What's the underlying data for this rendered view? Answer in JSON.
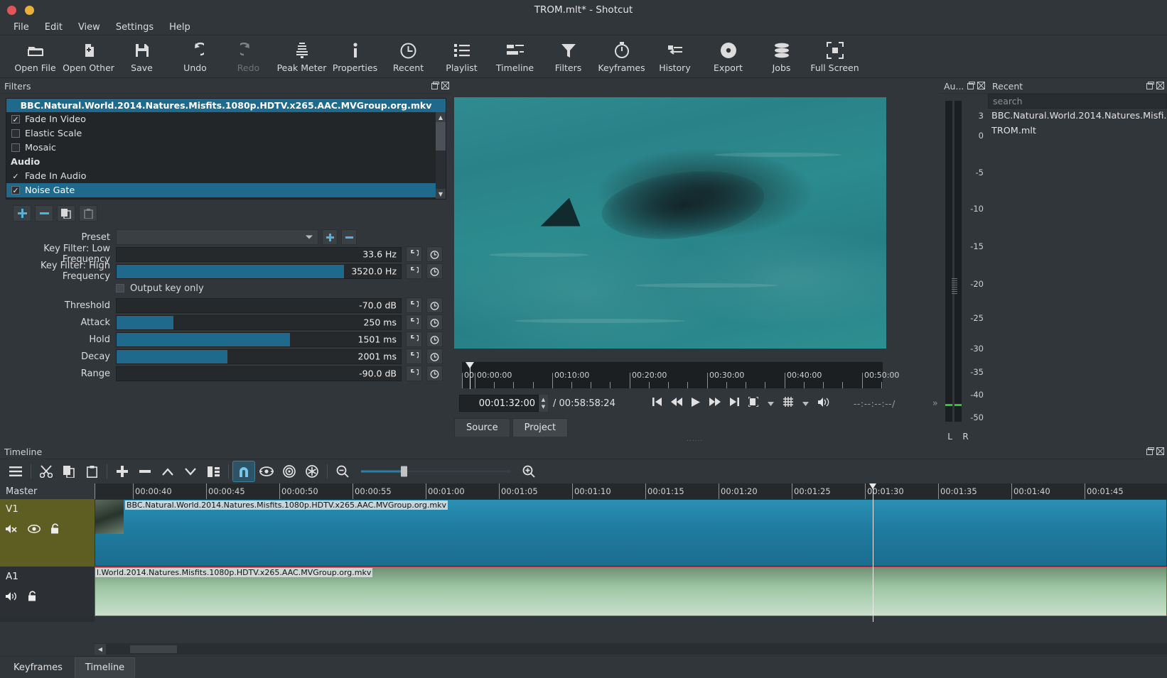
{
  "window": {
    "title": "TROM.mlt* - Shotcut",
    "buttons": [
      "close",
      "minimize"
    ]
  },
  "menubar": [
    {
      "label": "File"
    },
    {
      "label": "Edit"
    },
    {
      "label": "View"
    },
    {
      "label": "Settings"
    },
    {
      "label": "Help"
    }
  ],
  "toolbar": [
    {
      "label": "Open File",
      "icon": "folder-icon",
      "disabled": false
    },
    {
      "label": "Open Other",
      "icon": "open-other-icon",
      "disabled": false
    },
    {
      "label": "Save",
      "icon": "save-icon",
      "disabled": false
    },
    {
      "label": "Undo",
      "icon": "undo-icon",
      "disabled": false
    },
    {
      "label": "Redo",
      "icon": "redo-icon",
      "disabled": true
    },
    {
      "label": "Peak Meter",
      "icon": "peak-meter-icon",
      "disabled": false
    },
    {
      "label": "Properties",
      "icon": "info-icon",
      "disabled": false
    },
    {
      "label": "Recent",
      "icon": "clock-icon",
      "disabled": false
    },
    {
      "label": "Playlist",
      "icon": "list-icon",
      "disabled": false
    },
    {
      "label": "Timeline",
      "icon": "timeline-icon",
      "disabled": false
    },
    {
      "label": "Filters",
      "icon": "funnel-icon",
      "disabled": false
    },
    {
      "label": "Keyframes",
      "icon": "stopwatch-icon",
      "disabled": false
    },
    {
      "label": "History",
      "icon": "history-icon",
      "disabled": false
    },
    {
      "label": "Export",
      "icon": "disc-icon",
      "disabled": false
    },
    {
      "label": "Jobs",
      "icon": "stack-icon",
      "disabled": false
    },
    {
      "label": "Full Screen",
      "icon": "fullscreen-icon",
      "disabled": false
    }
  ],
  "filters_panel": {
    "dock_title": "Filters",
    "source_name": "BBC.Natural.World.2014.Natures.Misfits.1080p.HDTV.x265.AAC.MVGroup.org.mkv",
    "items": [
      {
        "label": "Fade In Video",
        "checked": true,
        "group": false,
        "selected": false
      },
      {
        "label": "Elastic Scale",
        "checked": false,
        "group": false,
        "selected": false
      },
      {
        "label": "Mosaic",
        "checked": false,
        "group": false,
        "selected": false
      },
      {
        "label": "Audio",
        "checked": null,
        "group": true,
        "selected": false
      },
      {
        "label": "Fade In Audio",
        "checked": true,
        "group": false,
        "selected": false
      },
      {
        "label": "Noise Gate",
        "checked": true,
        "group": false,
        "selected": true
      }
    ],
    "list_buttons": [
      {
        "name": "add-filter-button",
        "glyph": "+"
      },
      {
        "name": "remove-filter-button",
        "glyph": "−"
      },
      {
        "name": "copy-filters-button",
        "glyph": "copy-icon"
      },
      {
        "name": "paste-filters-button",
        "glyph": "paste-icon"
      }
    ],
    "preset": {
      "label": "Preset",
      "value": "",
      "add_label": "+",
      "remove_label": "−"
    },
    "parameters": [
      {
        "label": "Key Filter: Low Frequency",
        "value": "33.6 Hz",
        "fill_pct": 0
      },
      {
        "label": "Key Filter: High Frequency",
        "value": "3520.0 Hz",
        "fill_pct": 80
      },
      {
        "label": "Threshold",
        "value": "-70.0 dB",
        "fill_pct": 0
      },
      {
        "label": "Attack",
        "value": "250 ms",
        "fill_pct": 20
      },
      {
        "label": "Hold",
        "value": "1501 ms",
        "fill_pct": 61
      },
      {
        "label": "Decay",
        "value": "2001 ms",
        "fill_pct": 39
      },
      {
        "label": "Range",
        "value": "-90.0 dB",
        "fill_pct": 0
      }
    ],
    "checkbox": {
      "label": "Output key only",
      "checked": false
    }
  },
  "player": {
    "ruler_labels": [
      "00:00:00",
      "00:10:00",
      "00:20:00",
      "00:30:00",
      "00:40:00",
      "00:50:00"
    ],
    "ruler_prefix": "00",
    "position": "00:01:32:00",
    "duration": "00:58:58:24",
    "separator": "/",
    "in_out": "--:--:--:--",
    "in_out_sep": "/",
    "transport": [
      {
        "name": "skip-to-start-button",
        "icon": "skip-start-icon"
      },
      {
        "name": "rewind-button",
        "icon": "rewind-icon"
      },
      {
        "name": "play-button",
        "icon": "play-icon"
      },
      {
        "name": "fast-forward-button",
        "icon": "fast-forward-icon"
      },
      {
        "name": "skip-to-end-button",
        "icon": "skip-end-icon"
      },
      {
        "name": "toggle-zoom-button",
        "icon": "zoom-fit-icon"
      },
      {
        "name": "grid-button",
        "icon": "grid-icon"
      },
      {
        "name": "volume-button",
        "icon": "volume-icon"
      }
    ],
    "tabs": [
      {
        "label": "Source",
        "active": false
      },
      {
        "label": "Project",
        "active": true
      }
    ],
    "expand_label": "»"
  },
  "audio_meter": {
    "dock_title": "Au...",
    "scale": [
      "3",
      "0",
      "-5",
      "-10",
      "-15",
      "-20",
      "-25",
      "-30",
      "-35",
      "-40",
      "-50"
    ],
    "channels": [
      "L",
      "R"
    ]
  },
  "recent": {
    "dock_title": "Recent",
    "search_placeholder": "search",
    "items": [
      {
        "label": "BBC.Natural.World.2014.Natures.Misfi..."
      },
      {
        "label": "TROM.mlt"
      }
    ]
  },
  "timeline": {
    "dock_title": "Timeline",
    "toolbar": [
      {
        "name": "timeline-menu-button",
        "icon": "hamburger-icon",
        "active": false
      },
      {
        "name": "cut-button",
        "icon": "scissors-icon",
        "active": false
      },
      {
        "name": "copy-button",
        "icon": "copy-icon",
        "active": false
      },
      {
        "name": "paste-button",
        "icon": "paste-icon",
        "active": false
      },
      {
        "name": "append-button",
        "icon": "plus-icon",
        "active": false
      },
      {
        "name": "ripple-delete-button",
        "icon": "minus-icon",
        "active": false
      },
      {
        "name": "lift-button",
        "icon": "chevron-up-icon",
        "active": false
      },
      {
        "name": "overwrite-button",
        "icon": "chevron-down-icon",
        "active": false
      },
      {
        "name": "split-button",
        "icon": "split-icon",
        "active": false
      },
      {
        "name": "snap-button",
        "icon": "magnet-icon",
        "active": true
      },
      {
        "name": "scrub-while-dragging-button",
        "icon": "scrub-icon",
        "active": false
      },
      {
        "name": "ripple-button",
        "icon": "ripple-icon",
        "active": false
      },
      {
        "name": "ripple-all-tracks-button",
        "icon": "ripple-all-icon",
        "active": false
      },
      {
        "name": "zoom-out-button",
        "icon": "zoom-out-icon",
        "active": false
      },
      {
        "name": "zoom-in-button",
        "icon": "zoom-in-icon",
        "active": false
      }
    ],
    "master_label": "Master",
    "ruler_labels": [
      "00:00:40",
      "00:00:45",
      "00:00:50",
      "00:00:55",
      "00:01:00",
      "00:01:05",
      "00:01:10",
      "00:01:15",
      "00:01:20",
      "00:01:25",
      "00:01:30",
      "00:01:35",
      "00:01:40",
      "00:01:45"
    ],
    "tracks": [
      {
        "name": "V1",
        "type": "video",
        "clip_label": "BBC.Natural.World.2014.Natures.Misfits.1080p.HDTV.x265.AAC.MVGroup.org.mkv",
        "icons": [
          "mute-icon",
          "hide-icon",
          "lock-icon"
        ]
      },
      {
        "name": "A1",
        "type": "audio",
        "clip_label": "l.World.2014.Natures.Misfits.1080p.HDTV.x265.AAC.MVGroup.org.mkv",
        "icons": [
          "mute-icon",
          "lock-icon"
        ]
      }
    ],
    "playhead_position": "00:01:32"
  },
  "bottom_tabs": [
    {
      "label": "Keyframes",
      "active": false
    },
    {
      "label": "Timeline",
      "active": true
    }
  ],
  "colors": {
    "accent": "#1f6a8c",
    "background": "#31363b",
    "panel": "#232629",
    "video_track": "#1f7ba0",
    "audio_track": "#9dc5a3",
    "track_header_v1": "#5e5e23",
    "playhead": "#eaeaea"
  }
}
